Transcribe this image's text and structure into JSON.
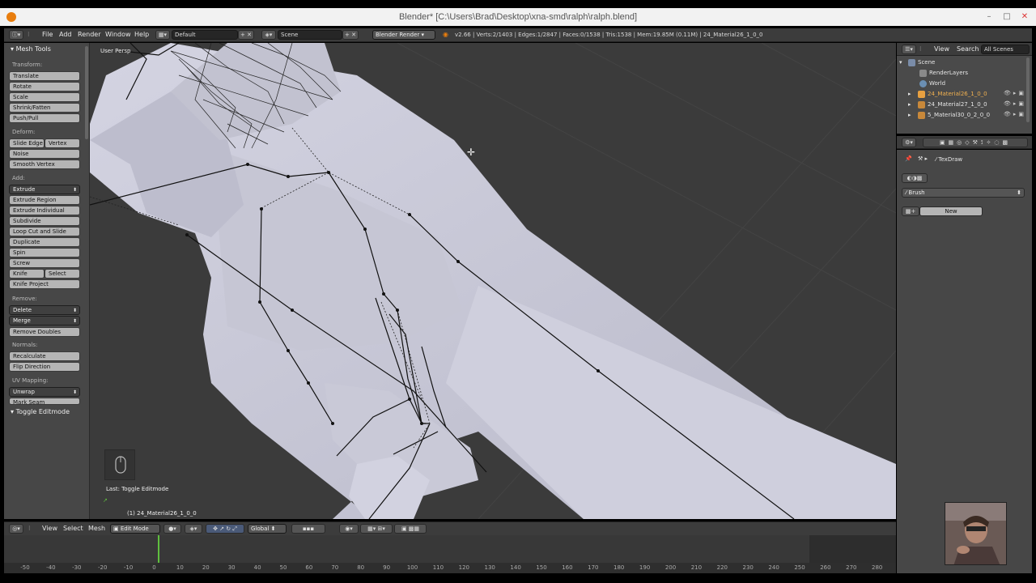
{
  "window": {
    "title": "Blender* [C:\\Users\\Brad\\Desktop\\xna-smd\\ralph\\ralph.blend]",
    "controls": [
      "–",
      "□",
      "✕"
    ]
  },
  "info_header": {
    "menus": [
      "File",
      "Add",
      "Render",
      "Window",
      "Help"
    ],
    "layout": "Default",
    "scene": "Scene",
    "engine": "Blender Render",
    "stats": "v2.66 | Verts:2/1403 | Edges:1/2847 | Faces:0/1538 | Tris:1538 | Mem:19.85M (0.11M) | 24_Material26_1_0_0"
  },
  "tool_shelf": {
    "title": "Mesh Tools",
    "sections": {
      "transform": "Transform:",
      "deform": "Deform:",
      "add": "Add:",
      "remove": "Remove:",
      "normals": "Normals:",
      "uv": "UV Mapping:"
    },
    "buttons": {
      "translate": "Translate",
      "rotate": "Rotate",
      "scale": "Scale",
      "shrink": "Shrink/Fatten",
      "push": "Push/Pull",
      "slide_edge": "Slide Edge",
      "vertex": "Vertex",
      "noise": "Noise",
      "smooth": "Smooth Vertex",
      "extrude": "Extrude",
      "extrude_region": "Extrude Region",
      "extrude_individual": "Extrude Individual",
      "subdivide": "Subdivide",
      "loop_cut": "Loop Cut and Slide",
      "duplicate": "Duplicate",
      "spin": "Spin",
      "screw": "Screw",
      "knife": "Knife",
      "select": "Select",
      "knife_project": "Knife Project",
      "delete": "Delete",
      "merge": "Merge",
      "remove_doubles": "Remove Doubles",
      "recalculate": "Recalculate",
      "flip": "Flip Direction",
      "unwrap": "Unwrap",
      "mark_seam": "Mark Seam"
    },
    "operator_panel": "Toggle Editmode"
  },
  "viewport": {
    "persp_label": "User Persp",
    "last_op": "Last: Toggle Editmode",
    "object_label": "(1) 24_Material26_1_0_0"
  },
  "outliner": {
    "menus": [
      "View",
      "Search"
    ],
    "filter": "All Scenes",
    "items": [
      "Scene",
      "RenderLayers",
      "World",
      "24_Material26_1_0_0",
      "24_Material27_1_0_0",
      "5_Material30_0_2_0_0"
    ]
  },
  "properties": {
    "context": "TexDraw",
    "brush": "Brush",
    "new_button": "New"
  },
  "view3d_header": {
    "menus": [
      "View",
      "Select",
      "Mesh"
    ],
    "mode": "Edit Mode",
    "orientation": "Global"
  },
  "timeline": {
    "ticks": [
      "-50",
      "-40",
      "-30",
      "-20",
      "-10",
      "0",
      "10",
      "20",
      "30",
      "40",
      "50",
      "60",
      "70",
      "80",
      "90",
      "100",
      "110",
      "120",
      "130",
      "140",
      "150",
      "160",
      "170",
      "180",
      "190",
      "200",
      "210",
      "220",
      "230",
      "240",
      "250",
      "260",
      "270",
      "280"
    ]
  },
  "colors": {
    "accent_orange": "#e87d0d",
    "frame_marker": "#5fbf3e",
    "mesh_surface": "#c8c8d8",
    "viewport_bg": "#3b3b3b"
  }
}
